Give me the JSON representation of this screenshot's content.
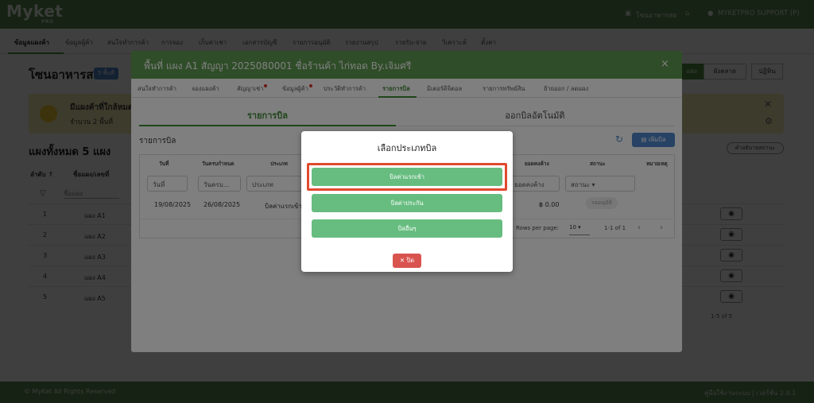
{
  "topbar": {
    "logo": "Myket",
    "logo_sub": "PRO",
    "store_label": "โซนอาหารสด",
    "user_label": "MYKETPRO SUPPORT (P)"
  },
  "main_nav": {
    "items": [
      {
        "label": "ข้อมูลแผงค้า"
      },
      {
        "label": "ข้อมูลผู้ค้า"
      },
      {
        "label": "สนใจทำการค้า"
      },
      {
        "label": "การจอง"
      },
      {
        "label": "เก็บค่าเช่า"
      },
      {
        "label": "เอกสารบัญชี"
      },
      {
        "label": "รายการอนุมัติ"
      },
      {
        "label": "รายงานสรุป"
      },
      {
        "label": "รายรับ-จ่าย"
      },
      {
        "label": "วิเคราะห์"
      },
      {
        "label": "ตั้งค่า"
      }
    ]
  },
  "page": {
    "title": "โซนอาหารสด",
    "title_badge": "5 พื้นที่",
    "right_tabs": [
      "แผง",
      "ผังตลาด",
      "ปฏิทิน"
    ],
    "alert_title": "มีแผงค้าที่ใกล้หมดสัญญา",
    "alert_sub": "จำนวน 2 พื้นที่",
    "section_title": "แผงทั้งหมด 5 แผง",
    "guide_label": "คำอธิบายสถานะ",
    "bg_columns": [
      "ลำดับ ↑",
      "ชื่อแผง/เลขที่"
    ],
    "bg_filter_placeholder": "ชื่อแผง",
    "bg_rows": [
      {
        "num": "1",
        "name": "แผง A1"
      },
      {
        "num": "2",
        "name": "แผง A2"
      },
      {
        "num": "3",
        "name": "แผง A3"
      },
      {
        "num": "4",
        "name": "แผง A4"
      },
      {
        "num": "5",
        "name": "แผง A5"
      }
    ],
    "bg_pagination": "1-5 of 5"
  },
  "footer": {
    "left": "© MyKet All Rights Reserved",
    "right": "คู่มือใช้งานระบบ | เวอร์ชั่น 2.0.1"
  },
  "dialog": {
    "title": "พื้นที่ แผง A1 สัญญา 2025080001 ชื่อร้านค้า ไก่ทอด By.เจิมศรี",
    "close_icon": "×",
    "tabs": [
      {
        "label": "สนใจทำการค้า",
        "dot": false
      },
      {
        "label": "จองแผงค้า",
        "dot": false
      },
      {
        "label": "สัญญาเช่า",
        "dot": true
      },
      {
        "label": "ข้อมูลผู้ค้า",
        "dot": true
      },
      {
        "label": "ประวัติทำการค้า",
        "dot": false
      },
      {
        "label": "รายการบิล",
        "dot": false
      },
      {
        "label": "มิเตอร์ดิจิตอล",
        "dot": false
      },
      {
        "label": "รายการทรัพย์สิน",
        "dot": false
      },
      {
        "label": "ย้ายออก / ลดแผง",
        "dot": false
      }
    ],
    "subtab_left": "รายการบิล",
    "subtab_right": "ออกบิลอัตโนมัติ",
    "bill_label": "รายการบิล",
    "add_bill_label": "เพิ่มบิล",
    "table": {
      "headers": [
        "วันที่",
        "วันครบกำหนด",
        "ประเภท",
        "ยอดคงค้าง",
        "สถานะ",
        "หมายเหตุ"
      ],
      "filter_date": "วันที่",
      "filter_due": "วันครบ...",
      "filter_type": "ประเภท",
      "filter_balance": "ยอดคงค้าง",
      "filter_status": "สถานะ",
      "row": {
        "date": "19/08/2025",
        "due": "26/08/2025",
        "type": "บิลค่าแรกเข้า",
        "balance": "฿ 0.00",
        "status": "รออนุมัติ"
      },
      "rows_per_page_label": "Rows per page:",
      "rows_per_page": "10",
      "range": "1-1 of 1"
    }
  },
  "bill_modal": {
    "title": "เลือกประเภทบิล",
    "options": [
      {
        "label": "บิลค่าแรกเข้า"
      },
      {
        "label": "บิลค่าประกัน"
      },
      {
        "label": "บิลอื่นๆ"
      }
    ],
    "close_label": "ปิด"
  },
  "colors": {
    "brand": "#5a8a4c",
    "option": "#67bd80",
    "highlight": "#e04a2f",
    "close": "#d9534f"
  }
}
